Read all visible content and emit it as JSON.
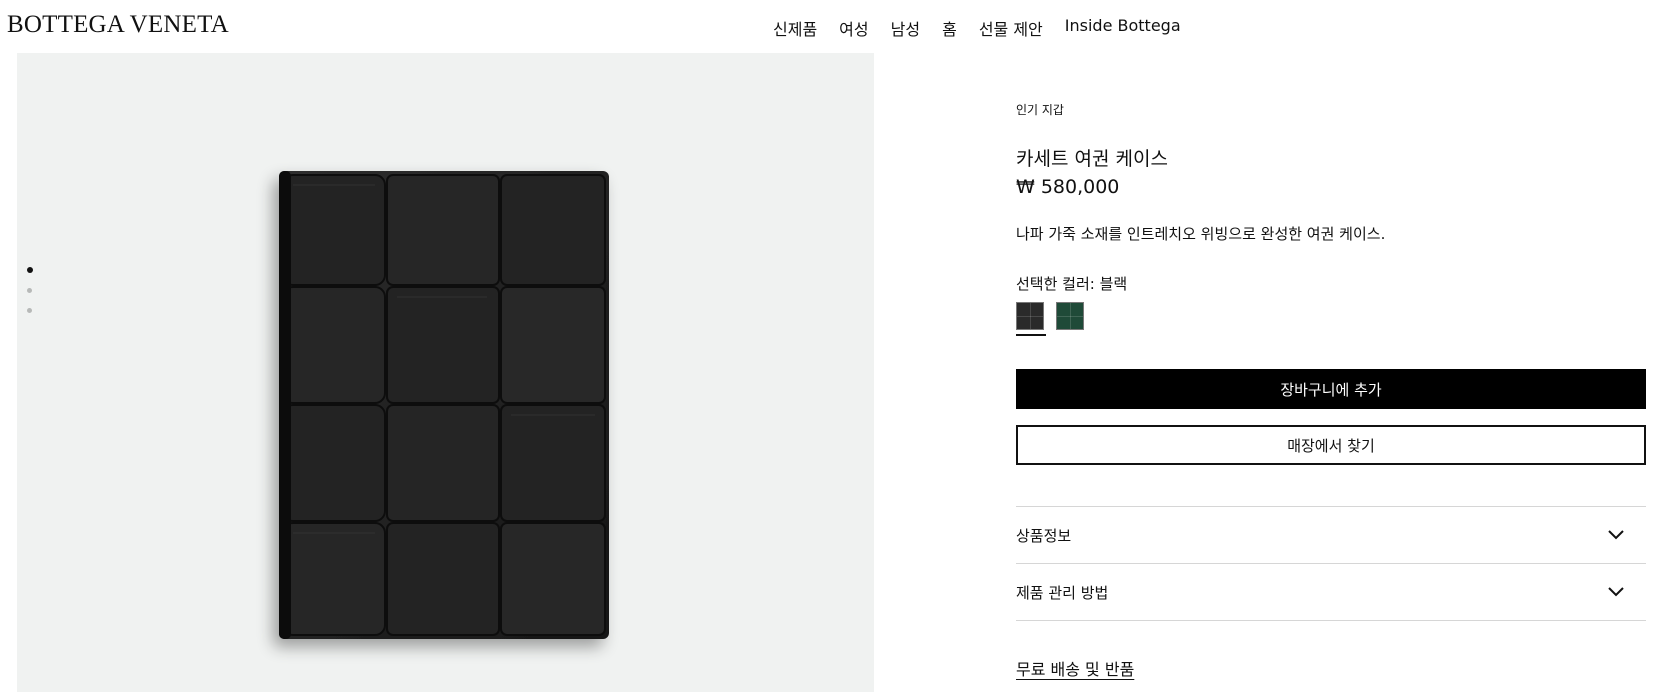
{
  "header": {
    "logo": "BOTTEGA VENETA",
    "nav": [
      "신제품",
      "여성",
      "남성",
      "홈",
      "선물 제안",
      "Inside Bottega"
    ]
  },
  "gallery": {
    "image_count": 3,
    "active_index": 0
  },
  "product": {
    "category": "인기 지갑",
    "name": "카세트 여권 케이스",
    "price": "₩ 580,000",
    "description": "나파 가죽 소재를 인트레치오 위빙으로 완성한 여권 케이스.",
    "color_label": "선택한 컬러: 블랙",
    "colors": [
      {
        "name": "black-swatch",
        "hex": "#2a2a2a",
        "selected": true
      },
      {
        "name": "green-swatch",
        "hex": "#1f4a38",
        "selected": false
      }
    ],
    "add_to_cart": "장바구니에 추가",
    "find_in_store": "매장에서 찾기",
    "accordions": [
      "상품정보",
      "제품 관리 방법"
    ],
    "shipping_link": "무료 배송 및 반품"
  }
}
